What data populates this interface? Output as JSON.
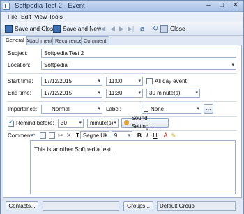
{
  "window": {
    "title": "Softpedia Test 2 - Event"
  },
  "menu": [
    "File",
    "Edit",
    "View",
    "Tools"
  ],
  "toolbar": {
    "save_close": "Save and Close",
    "save_new": "Save and New",
    "close": "Close"
  },
  "tabs": [
    "General",
    "Attachments",
    "Recurrence",
    "Comment"
  ],
  "form": {
    "subject_label": "Subject:",
    "subject_value": "Softpedia Test 2",
    "location_label": "Location:",
    "location_value": "Softpedia",
    "start_label": "Start time:",
    "start_date": "17/12/2015",
    "start_time": "11:00",
    "all_day_label": "All day event",
    "end_label": "End time:",
    "end_date": "17/12/2015",
    "end_time": "11:30",
    "duration": "30 minute(s)",
    "importance_label": "Importance:",
    "importance_value": "Normal",
    "label_label": "Label:",
    "label_value": "None",
    "label_more": "...",
    "remind_label": "Remind before:",
    "remind_value": "30",
    "remind_unit": "minute(s)",
    "sound_button": "Sound Setting...",
    "comment_label": "Comment:",
    "font_name": "Segoe UI",
    "font_size": "9",
    "comment_text": "This is another Softpedia test."
  },
  "bottom": {
    "contacts": "Contacts...",
    "groups": "Groups...",
    "group_value": "Default Group"
  }
}
